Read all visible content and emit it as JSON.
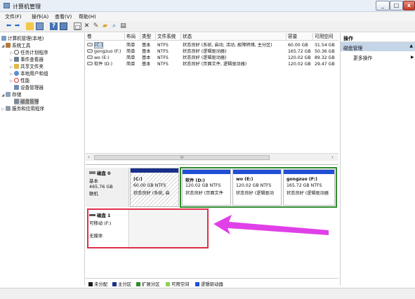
{
  "window": {
    "title": "计算机管理"
  },
  "menus": [
    "文件(F)",
    "操作(A)",
    "查看(V)",
    "帮助(H)"
  ],
  "tree": {
    "root": "计算机管理(本地)",
    "items": [
      "系统工具",
      "任务计划程序",
      "事件查看器",
      "共享文件夹",
      "本地用户和组",
      "性能",
      "设备管理器",
      "存储",
      "磁盘管理",
      "服务和应用程序"
    ]
  },
  "volumes": {
    "headers": [
      "卷",
      "布局",
      "类型",
      "文件系统",
      "状态",
      "容量",
      "可用空间"
    ],
    "rows": [
      {
        "name": "(C:)",
        "layout": "简单",
        "type": "基本",
        "fs": "NTFS",
        "status": "状态良好 (系统, 启动, 活动, 故障转储, 主分区)",
        "capacity": "60.00 GB",
        "free": "31.54 GB"
      },
      {
        "name": "gongzuo (F:)",
        "layout": "简单",
        "type": "基本",
        "fs": "NTFS",
        "status": "状态良好 (逻辑驱动器)",
        "capacity": "165.72 GB",
        "free": "50.36 GB"
      },
      {
        "name": "wo (E:)",
        "layout": "简单",
        "type": "基本",
        "fs": "NTFS",
        "status": "状态良好 (逻辑驱动器)",
        "capacity": "120.02 GB",
        "free": "89.32 GB"
      },
      {
        "name": "软件 (D:)",
        "layout": "简单",
        "type": "基本",
        "fs": "NTFS",
        "status": "状态良好 (页面文件, 逻辑驱动器)",
        "capacity": "120.02 GB",
        "free": "29.47 GB"
      }
    ],
    "scroll_thumb": "III"
  },
  "disk0": {
    "title": "磁盘 0",
    "type": "基本",
    "size": "465.76 GB",
    "state": "联机",
    "partitions": [
      {
        "name": "(C:)",
        "size": "60.00 GB NTFS",
        "status": "状态良好 (系统, 启"
      },
      {
        "name": "软件 (D:)",
        "size": "120.02 GB NTFS",
        "status": "状态良好 (页面文件"
      },
      {
        "name": "wo (E:)",
        "size": "120.02 GB NTFS",
        "status": "状态良好 (逻辑驱动"
      },
      {
        "name": "gongzuo (F:)",
        "size": "165.72 GB NTFS",
        "status": "状态良好 (逻辑驱动器"
      }
    ]
  },
  "disk1": {
    "title": "磁盘 1",
    "type": "可移动 (F:)",
    "state": "无媒体"
  },
  "legend": [
    {
      "label": "未分配",
      "color": "#1a1a1a"
    },
    {
      "label": "主分区",
      "color": "#1a2f8a"
    },
    {
      "label": "扩展分区",
      "color": "#2e8b2e"
    },
    {
      "label": "可用空间",
      "color": "#8fd14f"
    },
    {
      "label": "逻辑驱动器",
      "color": "#1f4fd6"
    }
  ],
  "actions": {
    "header": "操作",
    "section": "磁盘管理",
    "more": "更多操作"
  },
  "colors": {
    "highlight_box": "#e0304a",
    "arrow": "#e040e8",
    "extended_border": "#2e8b2e"
  }
}
